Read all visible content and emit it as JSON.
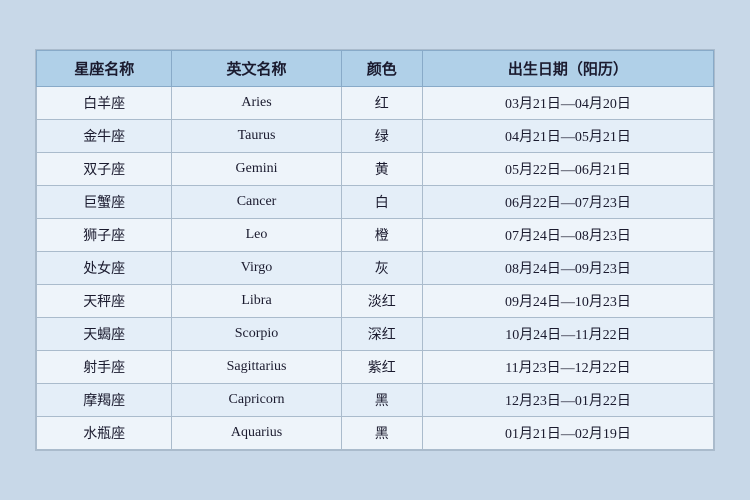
{
  "table": {
    "headers": {
      "chinese_name": "星座名称",
      "english_name": "英文名称",
      "color": "颜色",
      "birth_date": "出生日期（阳历）"
    },
    "rows": [
      {
        "chinese": "白羊座",
        "english": "Aries",
        "color": "红",
        "date": "03月21日—04月20日"
      },
      {
        "chinese": "金牛座",
        "english": "Taurus",
        "color": "绿",
        "date": "04月21日—05月21日"
      },
      {
        "chinese": "双子座",
        "english": "Gemini",
        "color": "黄",
        "date": "05月22日—06月21日"
      },
      {
        "chinese": "巨蟹座",
        "english": "Cancer",
        "color": "白",
        "date": "06月22日—07月23日"
      },
      {
        "chinese": "狮子座",
        "english": "Leo",
        "color": "橙",
        "date": "07月24日—08月23日"
      },
      {
        "chinese": "处女座",
        "english": "Virgo",
        "color": "灰",
        "date": "08月24日—09月23日"
      },
      {
        "chinese": "天秤座",
        "english": "Libra",
        "color": "淡红",
        "date": "09月24日—10月23日"
      },
      {
        "chinese": "天蝎座",
        "english": "Scorpio",
        "color": "深红",
        "date": "10月24日—11月22日"
      },
      {
        "chinese": "射手座",
        "english": "Sagittarius",
        "color": "紫红",
        "date": "11月23日—12月22日"
      },
      {
        "chinese": "摩羯座",
        "english": "Capricorn",
        "color": "黑",
        "date": "12月23日—01月22日"
      },
      {
        "chinese": "水瓶座",
        "english": "Aquarius",
        "color": "黑",
        "date": "01月21日—02月19日"
      }
    ]
  }
}
